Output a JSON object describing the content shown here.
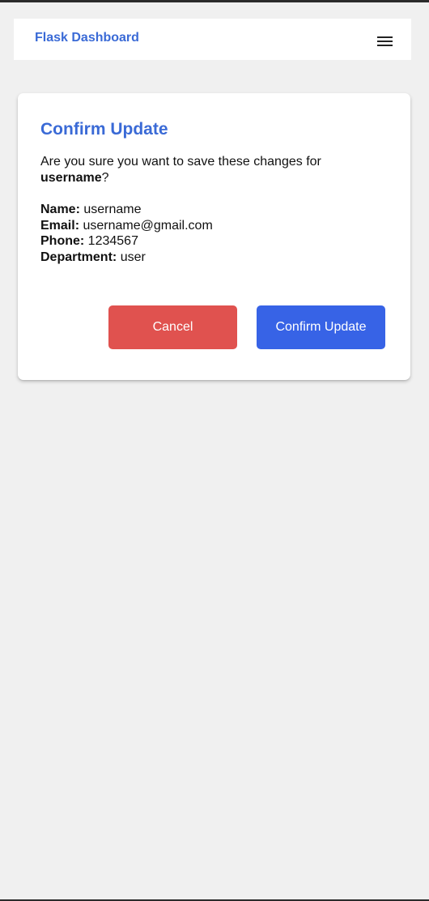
{
  "navbar": {
    "brand": "Flask Dashboard",
    "menu_icon": "hamburger-menu-icon"
  },
  "dialog": {
    "title": "Confirm Update",
    "prompt_prefix": "Are you sure you want to save these changes for ",
    "prompt_username": "username",
    "prompt_suffix": "?",
    "details": [
      {
        "label": "Name:",
        "value": "username"
      },
      {
        "label": "Email:",
        "value": "username@gmail.com"
      },
      {
        "label": "Phone:",
        "value": "1234567"
      },
      {
        "label": "Department:",
        "value": "user"
      }
    ],
    "cancel_label": "Cancel",
    "confirm_label": "Confirm Update"
  },
  "colors": {
    "accent": "#3a6ad6",
    "cancel": "#e0524f",
    "confirm": "#3763e6",
    "background": "#f0f0f0"
  }
}
